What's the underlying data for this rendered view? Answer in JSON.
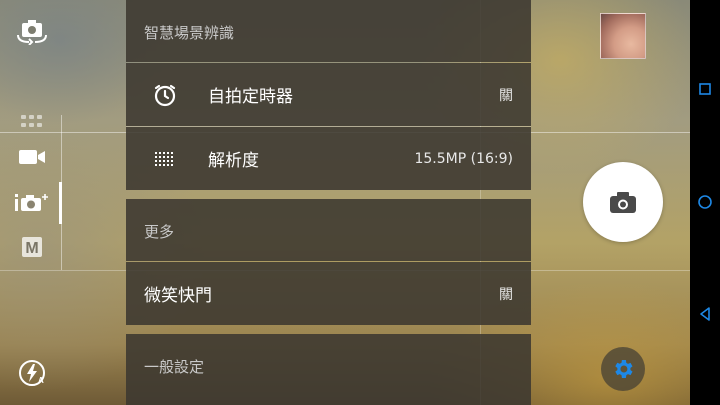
{
  "camera": {
    "left_rail": {
      "items": [
        {
          "icon": "switch-camera-icon"
        },
        {
          "icon": "more-modes-icon"
        },
        {
          "icon": "video-mode-icon"
        },
        {
          "icon": "superior-auto-mode-icon"
        },
        {
          "icon": "manual-mode-icon",
          "label": "M"
        },
        {
          "icon": "flash-auto-icon"
        }
      ]
    },
    "settings": {
      "sections": [
        {
          "header": "智慧場景辨識",
          "rows": [
            {
              "icon": "self-timer-icon",
              "label": "自拍定時器",
              "value": "關"
            },
            {
              "icon": "resolution-icon",
              "label": "解析度",
              "value": "15.5MP (16:9)"
            }
          ]
        },
        {
          "header": "更多",
          "rows": [
            {
              "label": "微笑快門",
              "value": "關"
            }
          ]
        },
        {
          "header": "一般設定",
          "rows": []
        }
      ]
    },
    "right_controls": {
      "thumbnail_icon": "last-photo-thumbnail",
      "shutter_icon": "camera-icon",
      "settings_icon": "gear-icon"
    }
  },
  "navbar": {
    "items": [
      {
        "icon": "recents-icon"
      },
      {
        "icon": "home-icon"
      },
      {
        "icon": "back-icon"
      }
    ]
  },
  "colors": {
    "accent": "#1e88e5",
    "panel_bg": "#3c3830"
  }
}
